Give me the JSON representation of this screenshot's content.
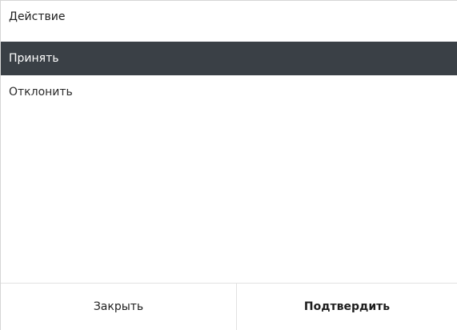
{
  "dialog": {
    "title": "Действие",
    "options": [
      {
        "label": "Принять",
        "selected": true
      },
      {
        "label": "Отклонить",
        "selected": false
      }
    ],
    "close_label": "Закрыть",
    "confirm_label": "Подтвердить"
  },
  "colors": {
    "selected_background": "#3a4046",
    "selected_text": "#ffffff",
    "text": "#1e1e1e"
  }
}
